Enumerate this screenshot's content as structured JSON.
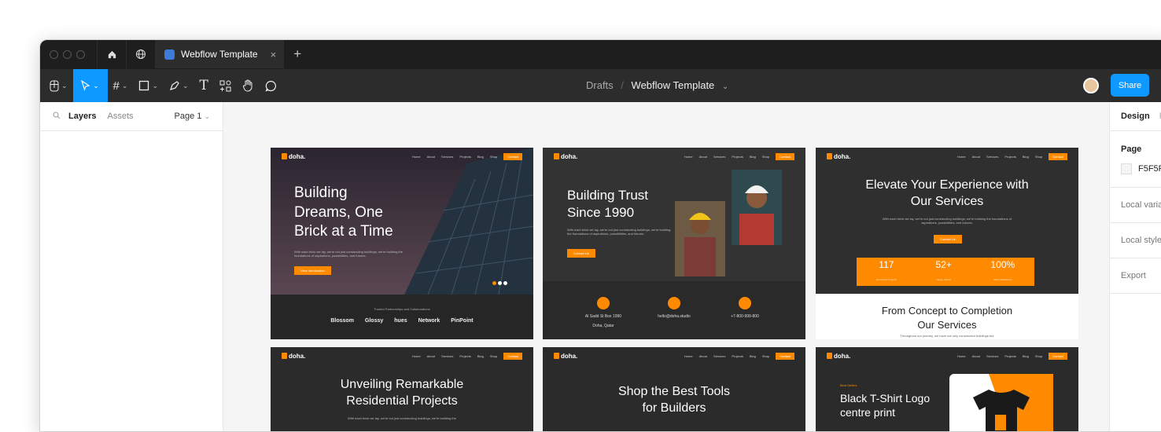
{
  "tabbar": {
    "file_tab": "Webflow Template",
    "close": "×",
    "new_tab": "+"
  },
  "toolbar": {
    "breadcrumb_root": "Drafts",
    "breadcrumb_sep": "/",
    "breadcrumb_file": "Webflow Template",
    "share_label": "Share"
  },
  "left_panel": {
    "tab_layers": "Layers",
    "tab_assets": "Assets",
    "page_select": "Page 1"
  },
  "right_panel": {
    "tab_design": "Design",
    "tab_prototype": "P",
    "page_title": "Page",
    "page_color": "F5F5F",
    "local_variables": "Local varia",
    "local_styles": "Local style",
    "export": "Export"
  },
  "frames": {
    "nav_logo": "doha.",
    "nav_links": [
      "Home",
      "About",
      "Services",
      "Projects",
      "Blog",
      "Shop"
    ],
    "nav_cta": "Contact",
    "f1": {
      "title_lines": [
        "Building",
        "Dreams, One",
        "Brick at a Time"
      ],
      "text": "With each brick we lay, we're not just constructing buildings; we're building the foundations of aspirations, possibilities, and futures.",
      "button": "View Introduction",
      "trusted": "Trusted Partnerships and Collaborations",
      "logos": [
        "Blossom",
        "Glossy",
        "hues",
        "Network",
        "PinPoint"
      ]
    },
    "f2": {
      "title_lines": [
        "Building Trust",
        "Since 1990"
      ],
      "text": "With each brick we lay, we're not just constructing buildings; we're building the foundations of aspirations, possibilities, and futures.",
      "button": "Contact Us",
      "contacts": [
        {
          "line1": "Al Sadd St Box 1990",
          "line2": "Doha, Qatar"
        },
        {
          "line1": "hello@doha.studio",
          "line2": ""
        },
        {
          "line1": "+7-800-999-800",
          "line2": ""
        }
      ]
    },
    "f3": {
      "title_lines": [
        "Elevate Your Experience with",
        "Our Services"
      ],
      "text": "With each brick we lay, we're not just constructing buildings; we're building the foundations of aspirations, possibilities, and futures.",
      "button": "Contact Us",
      "stats": [
        {
          "value": "117",
          "label": "Successful Projects"
        },
        {
          "value": "52+",
          "label": "Happy Clients"
        },
        {
          "value": "100%",
          "label": "Client Satisfaction"
        }
      ],
      "section_lines": [
        "From Concept to Completion",
        "Our Services"
      ],
      "section_text": "Throughout our journey, we have not only constructed buildings but"
    },
    "f4": {
      "title_lines": [
        "Unveiling Remarkable",
        "Residential Projects"
      ],
      "text": "With each brick we lay, we're not just constructing buildings; we're building the"
    },
    "f5": {
      "title_lines": [
        "Shop the Best Tools",
        "for Builders"
      ]
    },
    "f6": {
      "eyebrow": "Best Sellers",
      "title_lines": [
        "Black T-Shirt Logo",
        "centre print"
      ]
    }
  },
  "colors": {
    "accent": "#0d99ff",
    "brand_orange": "#ff8a00",
    "dark": "#2c2c2c"
  }
}
